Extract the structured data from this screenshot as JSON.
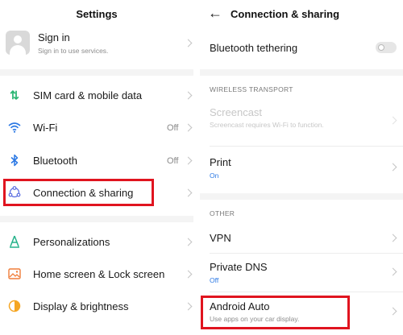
{
  "left": {
    "title": "Settings",
    "account": {
      "label": "Sign in",
      "sub": "Sign in to use services."
    },
    "items": [
      {
        "label": "SIM card & mobile data",
        "value": ""
      },
      {
        "label": "Wi-Fi",
        "value": "Off"
      },
      {
        "label": "Bluetooth",
        "value": "Off"
      },
      {
        "label": "Connection & sharing",
        "value": ""
      },
      {
        "label": "Personalizations",
        "value": ""
      },
      {
        "label": "Home screen & Lock screen",
        "value": ""
      },
      {
        "label": "Display & brightness",
        "value": ""
      }
    ]
  },
  "right": {
    "title": "Connection & sharing",
    "bluetooth_tethering": {
      "label": "Bluetooth tethering",
      "enabled": false
    },
    "section_wireless": "WIRELESS TRANSPORT",
    "screencast": {
      "label": "Screencast",
      "sub": "Screencast requires Wi-Fi to function."
    },
    "print": {
      "label": "Print",
      "sub": "On"
    },
    "section_other": "OTHER",
    "vpn": {
      "label": "VPN"
    },
    "private_dns": {
      "label": "Private DNS",
      "sub": "Off"
    },
    "android_auto": {
      "label": "Android Auto",
      "sub": "Use apps on your car display."
    }
  },
  "colors": {
    "highlight": "#e0141f",
    "accent": "#2b78e4",
    "sim": "#2bb673",
    "wifi": "#2b78e4",
    "bluetooth": "#2b78e4",
    "connection": "#5b6ee1",
    "personalize": "#25b28a",
    "home": "#f07d3a",
    "display": "#f5a623"
  }
}
